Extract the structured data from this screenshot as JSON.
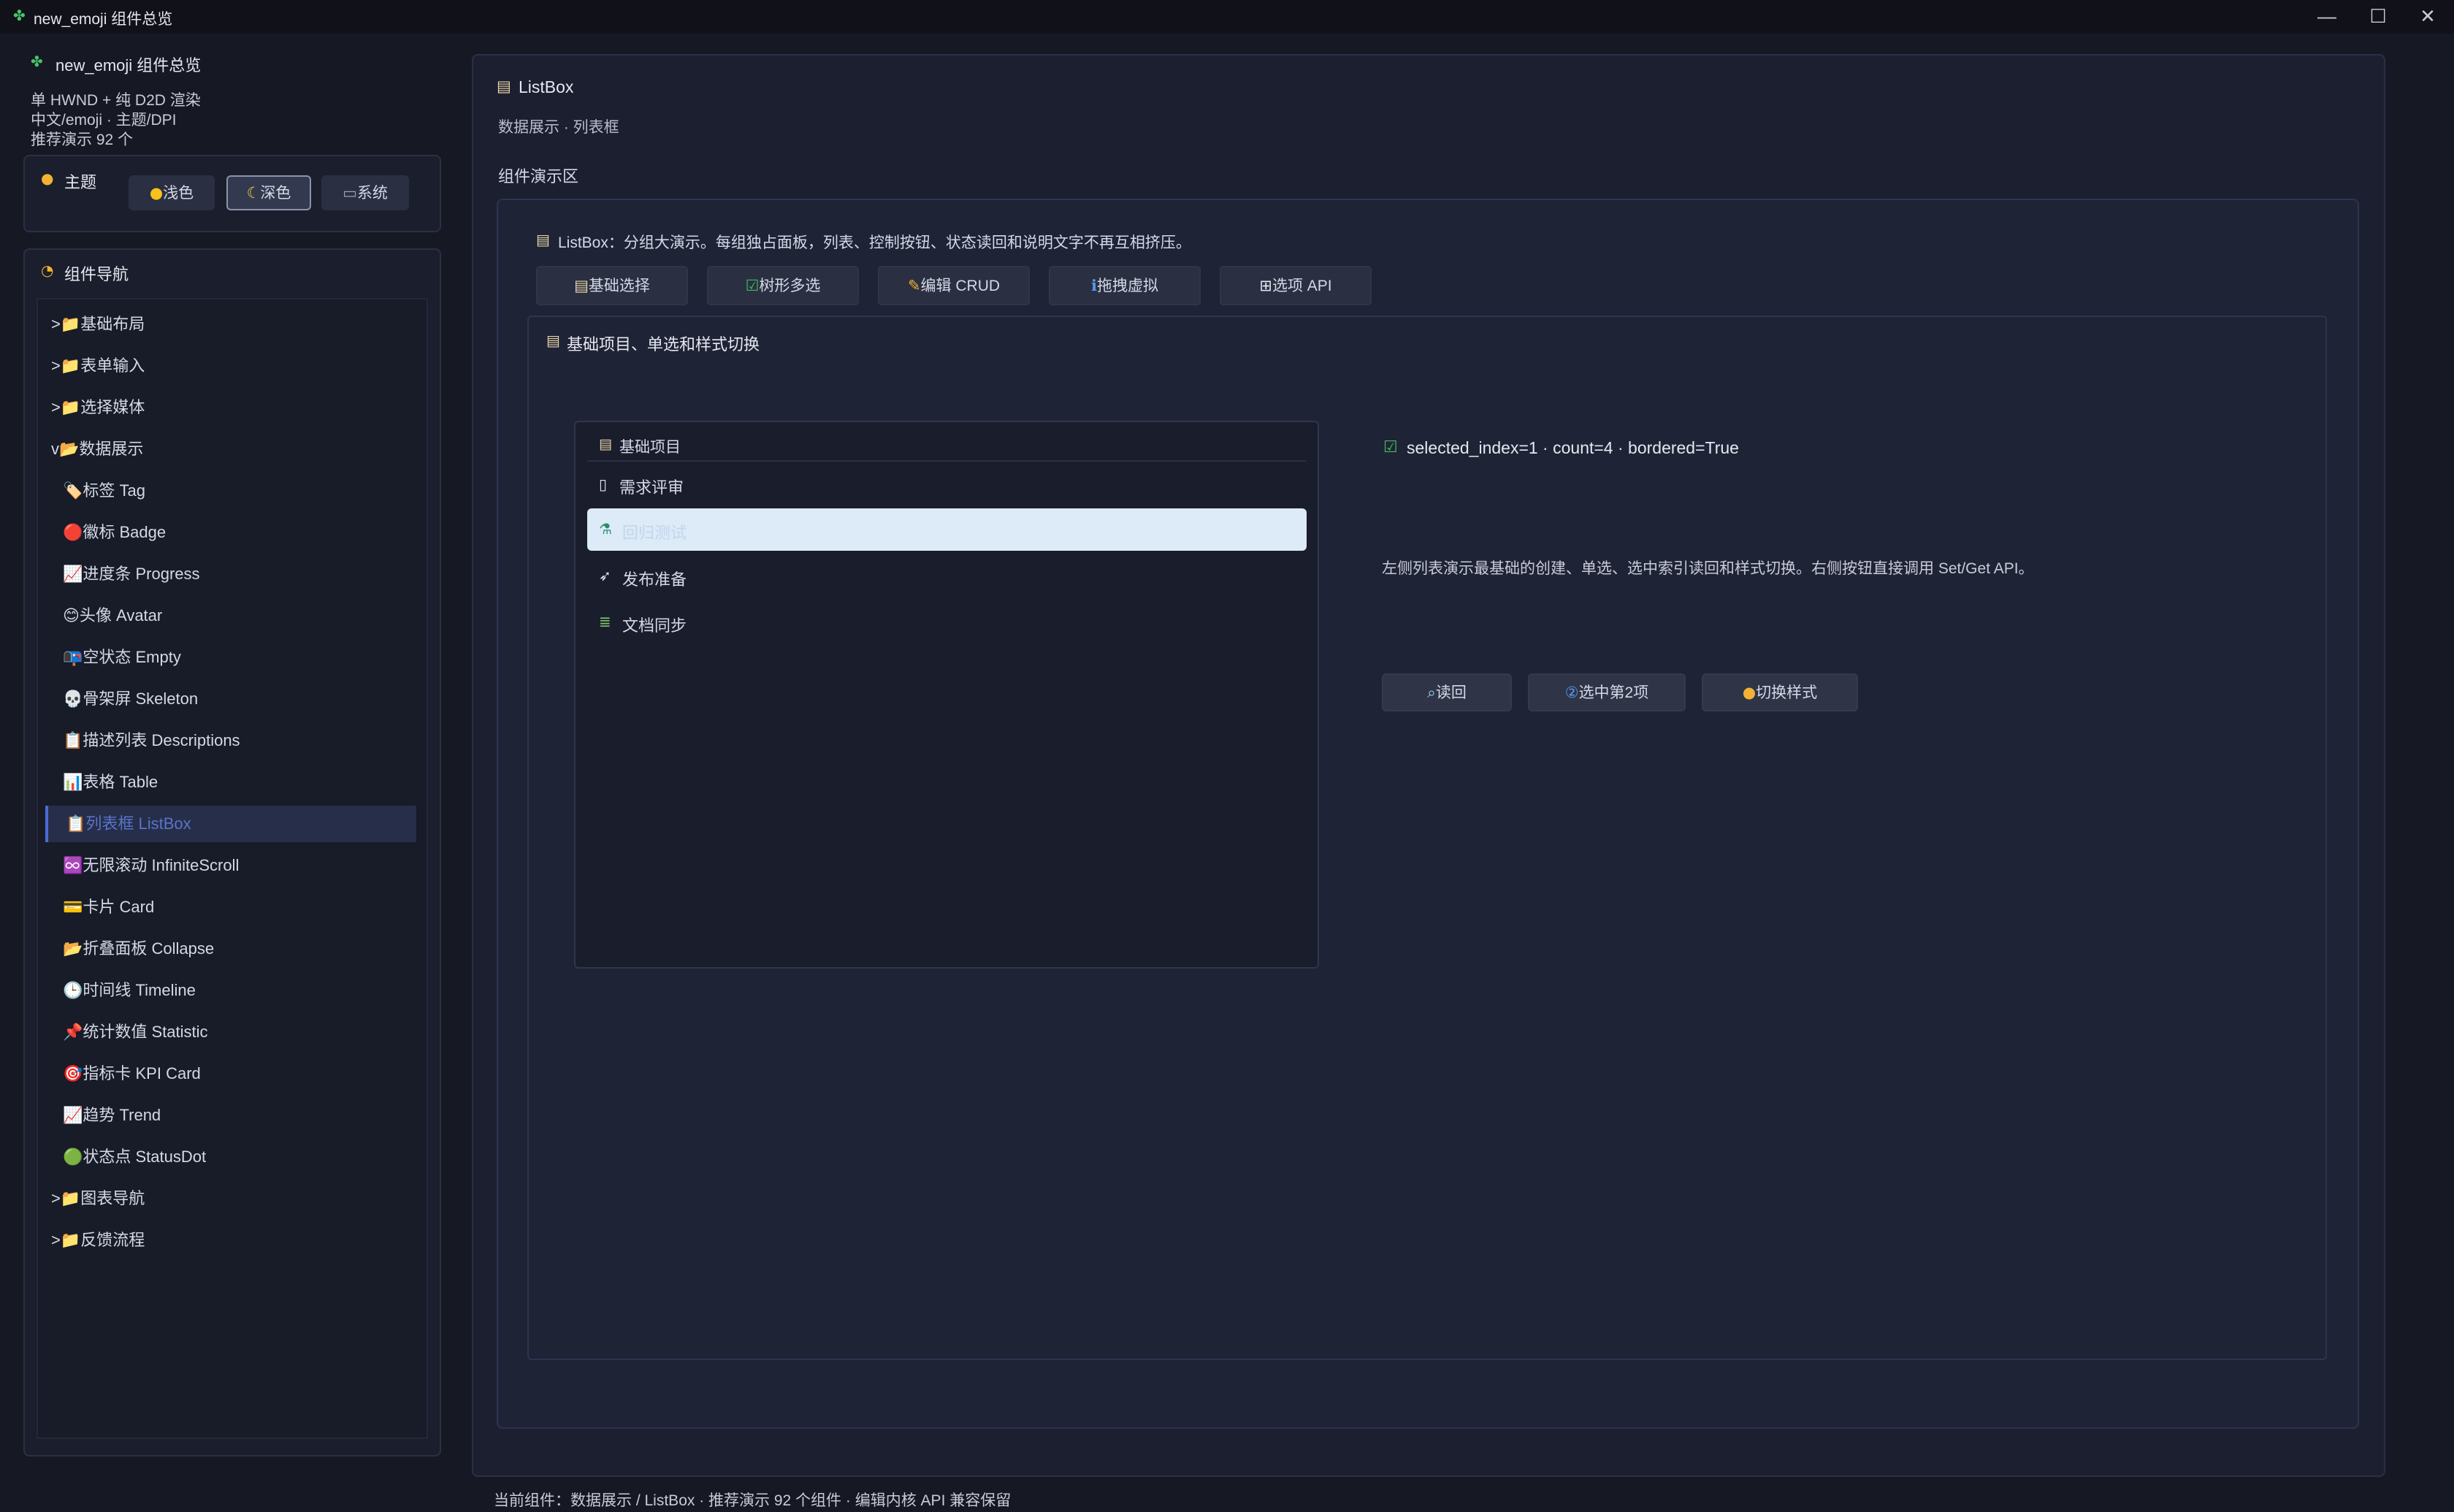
{
  "window": {
    "icon": "puzzle-icon",
    "title": "new_emoji 组件总览",
    "controls": [
      "minimize",
      "maximize",
      "close"
    ]
  },
  "sidebar": {
    "app_icon": "puzzle-icon",
    "app_title": "new_emoji 组件总览",
    "info": [
      "单 HWND + 纯 D2D 渲染",
      "中文/emoji · 主题/DPI",
      "推荐演示 92 个"
    ],
    "theme": {
      "label": "主题",
      "icon": "palette-icon",
      "options": [
        {
          "label": "浅色",
          "icon": "sun-icon"
        },
        {
          "label": "深色",
          "icon": "moon-icon",
          "active": true
        },
        {
          "label": "系统",
          "icon": "laptop-icon"
        }
      ]
    },
    "nav": {
      "label": "组件导航",
      "icon": "compass-icon",
      "items": [
        {
          "label": ">📁基础布局",
          "level": 0
        },
        {
          "label": ">📁表单输入",
          "level": 0
        },
        {
          "label": ">📁选择媒体",
          "level": 0
        },
        {
          "label": "v📂数据展示",
          "level": 0
        },
        {
          "label": "🏷️标签 Tag",
          "level": 1
        },
        {
          "label": "🔴徽标 Badge",
          "level": 1
        },
        {
          "label": "📈进度条 Progress",
          "level": 1
        },
        {
          "label": "😊头像 Avatar",
          "level": 1
        },
        {
          "label": "📭空状态 Empty",
          "level": 1
        },
        {
          "label": "💀骨架屏 Skeleton",
          "level": 1
        },
        {
          "label": "📋描述列表 Descriptions",
          "level": 1
        },
        {
          "label": "📊表格 Table",
          "level": 1
        },
        {
          "label": "📋列表框 ListBox",
          "level": 1,
          "selected": true
        },
        {
          "label": "♾️无限滚动 InfiniteScroll",
          "level": 1
        },
        {
          "label": "💳卡片 Card",
          "level": 1
        },
        {
          "label": "📂折叠面板 Collapse",
          "level": 1
        },
        {
          "label": "🕒时间线 Timeline",
          "level": 1
        },
        {
          "label": "📌统计数值 Statistic",
          "level": 1
        },
        {
          "label": "🎯指标卡 KPI Card",
          "level": 1
        },
        {
          "label": "📈趋势 Trend",
          "level": 1
        },
        {
          "label": "🟢状态点 StatusDot",
          "level": 1
        },
        {
          "label": ">📁图表导航",
          "level": 0
        },
        {
          "label": ">📁反馈流程",
          "level": 0
        }
      ]
    }
  },
  "main": {
    "title": "ListBox",
    "title_icon": "clipboard-icon",
    "subtitle": "数据展示 · 列表框",
    "demo_label": "组件演示区",
    "demo_desc": "ListBox：分组大演示。每组独占面板，列表、控制按钮、状态读回和说明文字不再互相挤压。",
    "demo_desc_icon": "clipboard-icon",
    "tabs": [
      {
        "label": "基础选择",
        "icon": "clipboard-icon"
      },
      {
        "label": "树形多选",
        "icon": "check-box-icon"
      },
      {
        "label": "编辑 CRUD",
        "icon": "pencil-icon"
      },
      {
        "label": "拖拽虚拟",
        "icon": "info-icon"
      },
      {
        "label": "选项 API",
        "icon": "grid-icon"
      }
    ],
    "section_title": "基础项目、单选和样式切换",
    "section_icon": "clipboard-icon",
    "listbox": {
      "header": "基础项目",
      "header_icon": "clipboard-icon",
      "items": [
        {
          "label": "需求评审",
          "icon": "document-icon"
        },
        {
          "label": "回归测试",
          "icon": "test-tube-icon",
          "selected": true
        },
        {
          "label": "发布准备",
          "icon": "rocket-icon"
        },
        {
          "label": "文档同步",
          "icon": "books-icon"
        }
      ]
    },
    "status": "selected_index=1 · count=4 · bordered=True",
    "status_icon": "check-box-icon",
    "hint": "左侧列表演示最基础的创建、单选、选中索引读回和样式切换。右侧按钮直接调用 Set/Get API。",
    "actions": [
      {
        "label": "读回",
        "icon": "magnifier-icon"
      },
      {
        "label": "选中第2项",
        "icon": "number-2-icon"
      },
      {
        "label": "切换样式",
        "icon": "palette-icon"
      }
    ]
  },
  "statusbar": "当前组件：数据展示 / ListBox · 推荐演示 92 个组件 · 编辑内核 API 兼容保留",
  "colors": {
    "background": "#161823",
    "panel": "#1c1f30",
    "accent": "#4d6ad2",
    "selection": "#ddeaf7"
  }
}
